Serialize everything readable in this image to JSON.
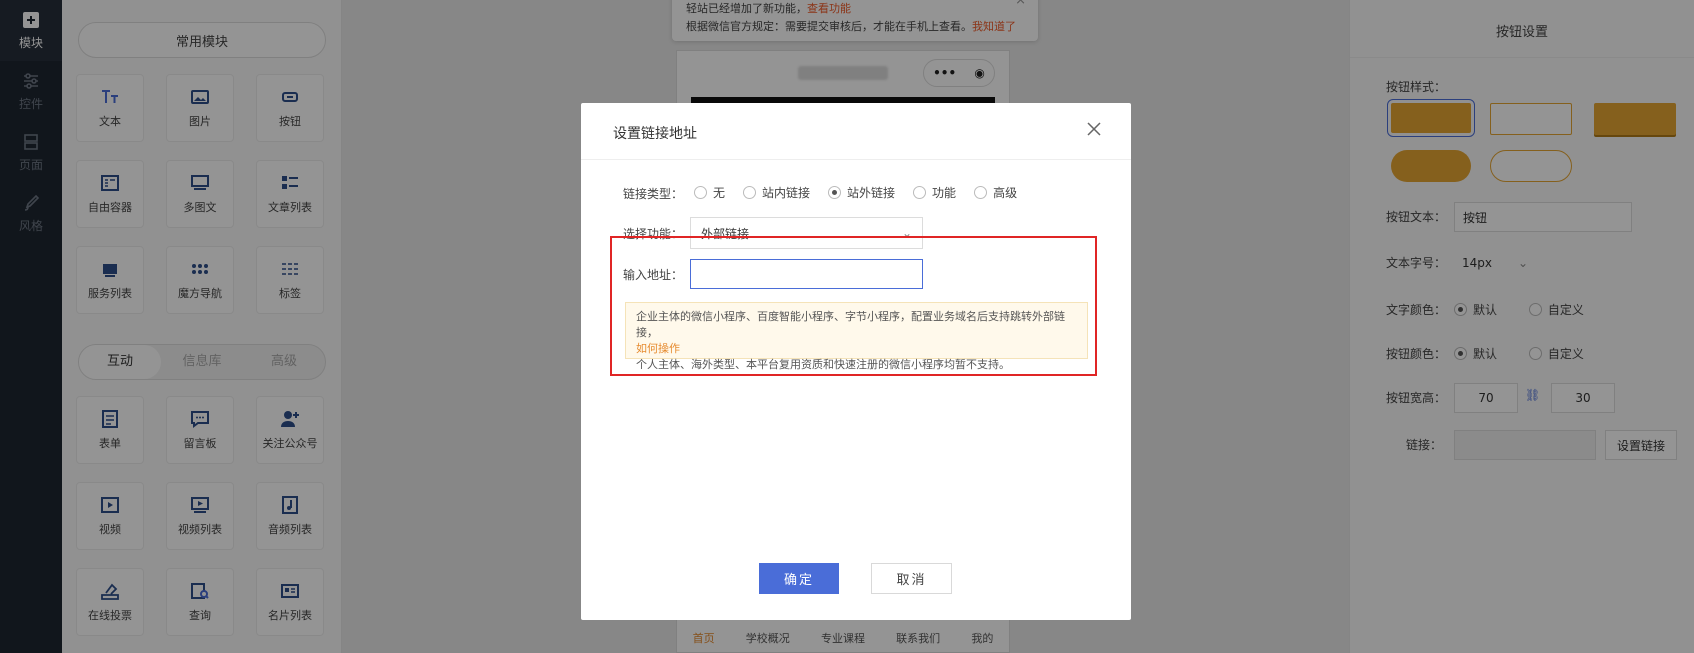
{
  "rail": [
    {
      "label": "模块",
      "icon": "plus-box-icon",
      "active": true
    },
    {
      "label": "控件",
      "icon": "sliders-icon"
    },
    {
      "label": "页面",
      "icon": "pages-icon"
    },
    {
      "label": "风格",
      "icon": "brush-icon"
    }
  ],
  "modules": {
    "common_header": "常用模块",
    "common": [
      "文本",
      "图片",
      "按钮",
      "自由容器",
      "多图文",
      "文章列表",
      "服务列表",
      "魔方导航",
      "标签"
    ],
    "tabs": [
      "互动",
      "信息库",
      "高级"
    ],
    "interactive": [
      "表单",
      "留言板",
      "关注公众号",
      "视频",
      "视频列表",
      "音频列表",
      "在线投票",
      "查询",
      "名片列表"
    ]
  },
  "toast": {
    "line1_prefix": "轻站已经增加了新功能，",
    "line1_link": "查看功能",
    "line2_prefix": "根据微信官方规定：需要提交审核后，才能在手机上查看。",
    "line2_link": "我知道了",
    "close": "×"
  },
  "phone": {
    "capsule_dots": "•••",
    "capsule_target": "◉",
    "tabbar": [
      "首页",
      "学校概况",
      "专业课程",
      "联系我们",
      "我的"
    ]
  },
  "settings": {
    "title": "按钮设置",
    "style_label": "按钮样式：",
    "text_label": "按钮文本：",
    "text_value": "按钮",
    "fontsize_label": "文本字号：",
    "fontsize_value": "14px",
    "textcolor_label": "文字颜色：",
    "btncolor_label": "按钮颜色：",
    "opt_default": "默认",
    "opt_custom": "自定义",
    "size_label": "按钮宽高：",
    "width_value": "70",
    "height_value": "30",
    "link_label": "链接：",
    "set_link_button": "设置链接",
    "accent": "#e6a532"
  },
  "modal": {
    "title": "设置链接地址",
    "type_label": "链接类型：",
    "types": [
      "无",
      "站内链接",
      "站外链接",
      "功能",
      "高级"
    ],
    "selected_type": "站外链接",
    "func_label": "选择功能：",
    "func_value": "外部链接",
    "url_label": "输入地址：",
    "url_placeholder": "",
    "tip_line1": "企业主体的微信小程序、百度智能小程序、字节小程序，配置业务域名后支持跳转外部链接，",
    "tip_link": "如何操作",
    "tip_line2": "个人主体、海外类型、本平台复用资质和快速注册的微信小程序均暂不支持。",
    "ok": "确定",
    "cancel": "取消",
    "primary_color": "#4a6dd8",
    "highlight_color": "#e02525"
  }
}
